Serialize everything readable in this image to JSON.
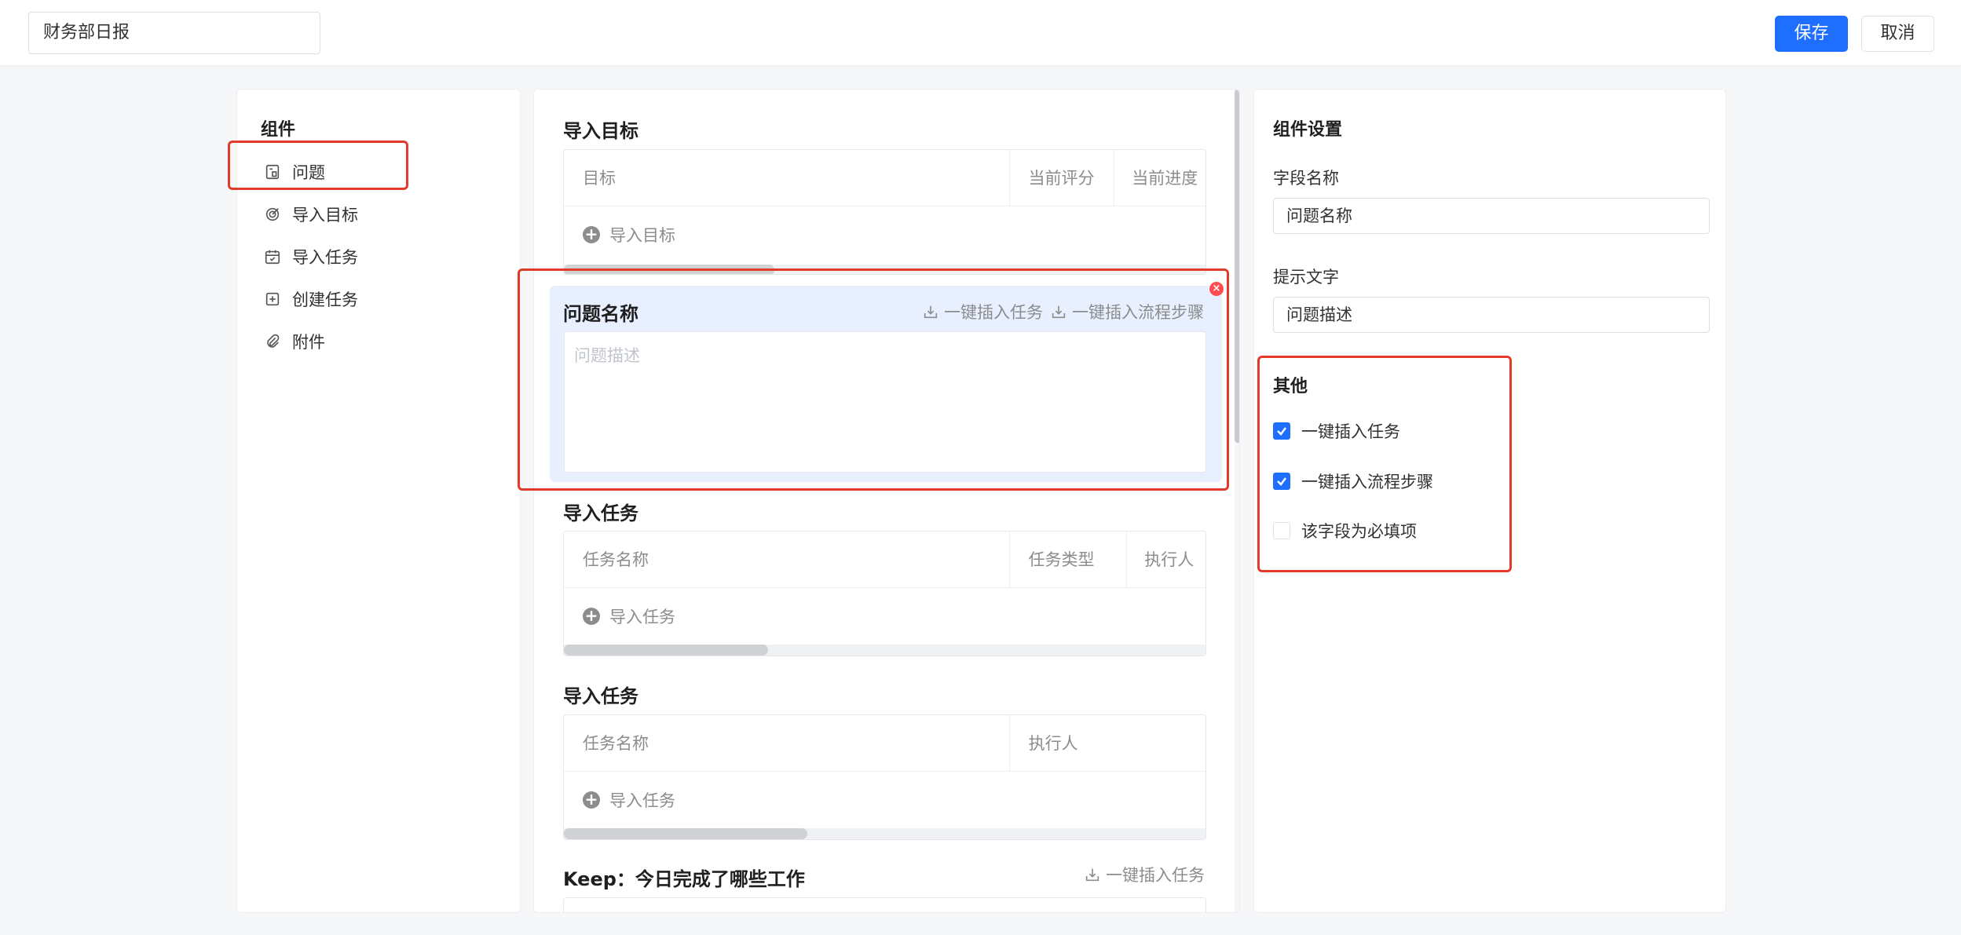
{
  "header": {
    "report_title": "财务部日报",
    "save_label": "保存",
    "cancel_label": "取消"
  },
  "components": {
    "heading": "组件",
    "items": [
      {
        "label": "问题",
        "icon": "document-icon"
      },
      {
        "label": "导入目标",
        "icon": "target-icon"
      },
      {
        "label": "导入任务",
        "icon": "calendar-icon"
      },
      {
        "label": "创建任务",
        "icon": "plus-square-icon"
      },
      {
        "label": "附件",
        "icon": "paperclip-icon"
      }
    ]
  },
  "canvas": {
    "goals_section": {
      "title": "导入目标",
      "columns": [
        "目标",
        "当前评分",
        "当前进度"
      ],
      "add_label": "导入目标"
    },
    "issue_block": {
      "title": "问题名称",
      "actions": [
        "一键插入任务",
        "一键插入流程步骤"
      ],
      "placeholder": "问题描述"
    },
    "tasks_section_1": {
      "title": "导入任务",
      "columns": [
        "任务名称",
        "任务类型",
        "执行人"
      ],
      "add_label": "导入任务"
    },
    "tasks_section_2": {
      "title": "导入任务",
      "columns": [
        "任务名称",
        "执行人"
      ],
      "add_label": "导入任务"
    },
    "keep_section": {
      "title": "Keep：今日完成了哪些工作",
      "action": "一键插入任务"
    }
  },
  "settings": {
    "heading": "组件设置",
    "field_name_label": "字段名称",
    "field_name_value": "问题名称",
    "hint_label": "提示文字",
    "hint_value": "问题描述",
    "other_heading": "其他",
    "options": [
      {
        "label": "一键插入任务",
        "checked": true
      },
      {
        "label": "一键插入流程步骤",
        "checked": true
      },
      {
        "label": "该字段为必填项",
        "checked": false
      }
    ]
  },
  "colors": {
    "primary": "#1e6fff",
    "highlight": "#e23b2b",
    "selected_block_bg": "#e8f0ff"
  }
}
